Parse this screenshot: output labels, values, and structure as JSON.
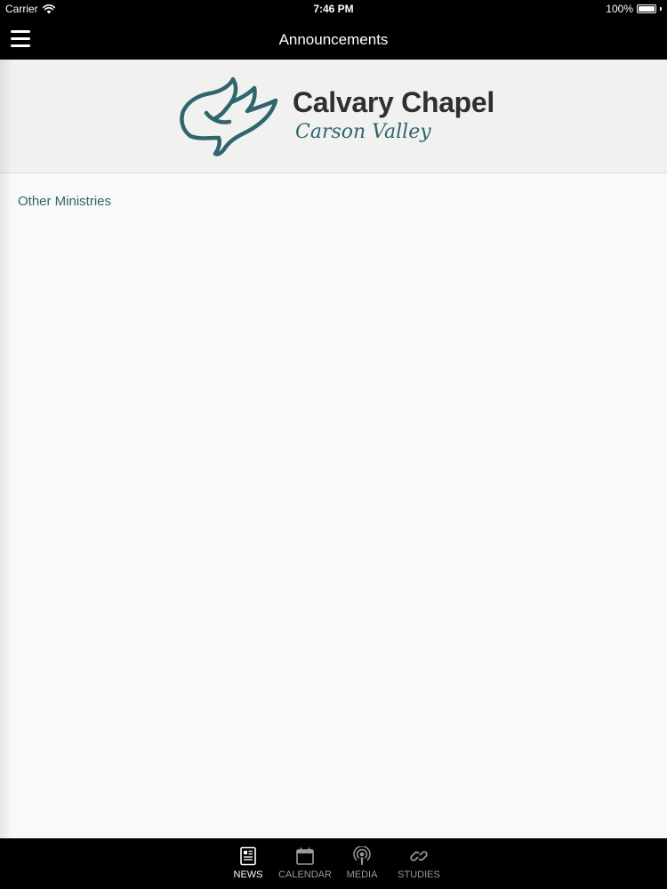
{
  "status_bar": {
    "carrier": "Carrier",
    "time": "7:46 PM",
    "battery": "100%",
    "battery_level": 1.0
  },
  "nav": {
    "title": "Announcements",
    "menu_icon": "hamburger-menu-icon"
  },
  "logo": {
    "title": "Calvary Chapel",
    "subtitle": "Carson Valley",
    "icon": "dove-icon"
  },
  "content": {
    "link_label": "Other Ministries"
  },
  "tabs": [
    {
      "label": "NEWS",
      "icon": "news-icon",
      "active": true
    },
    {
      "label": "CALENDAR",
      "icon": "calendar-icon",
      "active": false
    },
    {
      "label": "MEDIA",
      "icon": "podcast-icon",
      "active": false
    },
    {
      "label": "STUDIES",
      "icon": "link-icon",
      "active": false
    }
  ],
  "colors": {
    "brand_teal": "#2e6670",
    "bar_background": "#000000",
    "banner_background": "#f1f1ef",
    "tab_inactive": "#9a9a9a",
    "tab_active": "#ffffff"
  }
}
